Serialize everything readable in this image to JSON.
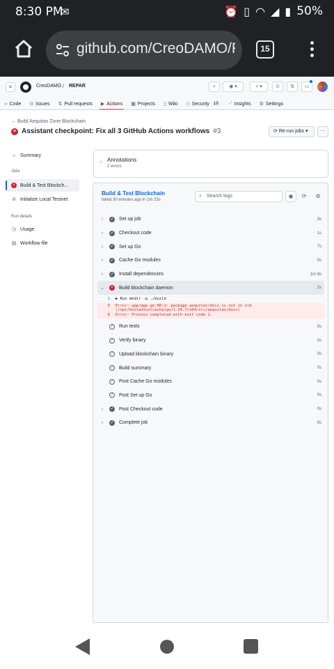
{
  "status_bar": {
    "time": "8:30 PM",
    "battery": "50%"
  },
  "browser": {
    "url": "github.com/CreoDAMO/R",
    "tab_count": "15"
  },
  "header": {
    "owner": "CreoDAMO",
    "separator": "/",
    "repo": "REPAR"
  },
  "repo_nav": [
    {
      "label": "Code",
      "icon": "code-icon"
    },
    {
      "label": "Issues",
      "icon": "issue-icon"
    },
    {
      "label": "Pull requests",
      "icon": "pull-request-icon"
    },
    {
      "label": "Actions",
      "icon": "actions-icon"
    },
    {
      "label": "Projects",
      "icon": "table-icon"
    },
    {
      "label": "Wiki",
      "icon": "book-icon"
    },
    {
      "label": "Security",
      "icon": "shield-icon",
      "count": "19"
    },
    {
      "label": "Insights",
      "icon": "graph-icon"
    },
    {
      "label": "Settings",
      "icon": "gear-icon"
    }
  ],
  "run": {
    "back_link": "Build Aequitas Zone Blockchain",
    "title": "Assistant checkpoint: Fix all 3 GitHub Actions workflows",
    "number": "#3",
    "rerun_label": "Re-run jobs"
  },
  "sidebar": {
    "summary": "Summary",
    "jobs_heading": "Jobs",
    "jobs": [
      {
        "label": "Build & Test Blockch...",
        "status": "failed"
      },
      {
        "label": "Initialize Local Testnet",
        "status": "skipped"
      }
    ],
    "run_details_heading": "Run details",
    "details": [
      {
        "label": "Usage"
      },
      {
        "label": "Workflow file"
      }
    ]
  },
  "annotations": {
    "title": "Annotations",
    "subtitle": "2 errors"
  },
  "job": {
    "name": "Build & Test Blockchain",
    "meta": "failed 30 minutes ago in 1m 23s",
    "search_placeholder": "Search logs"
  },
  "steps": [
    {
      "name": "Set up job",
      "duration": "3s",
      "status": "success",
      "expandable": true
    },
    {
      "name": "Checkout code",
      "duration": "1s",
      "status": "success",
      "expandable": true
    },
    {
      "name": "Set up Go",
      "duration": "7s",
      "status": "success",
      "expandable": true
    },
    {
      "name": "Cache Go modules",
      "duration": "0s",
      "status": "success",
      "expandable": true
    },
    {
      "name": "Install dependencies",
      "duration": "1m 8s",
      "status": "success",
      "expandable": true
    },
    {
      "name": "Build blockchain daemon",
      "duration": "2s",
      "status": "failure",
      "expandable": true,
      "expanded": true
    },
    {
      "name": "Run tests",
      "duration": "0s",
      "status": "skipped",
      "expandable": false
    },
    {
      "name": "Verify binary",
      "duration": "0s",
      "status": "skipped",
      "expandable": false
    },
    {
      "name": "Upload blockchain binary",
      "duration": "0s",
      "status": "skipped",
      "expandable": false
    },
    {
      "name": "Build summary",
      "duration": "0s",
      "status": "skipped",
      "expandable": false
    },
    {
      "name": "Post Cache Go modules",
      "duration": "0s",
      "status": "skipped",
      "expandable": false
    },
    {
      "name": "Post Set up Go",
      "duration": "0s",
      "status": "skipped",
      "expandable": false
    },
    {
      "name": "Post Checkout code",
      "duration": "0s",
      "status": "success",
      "expandable": true
    },
    {
      "name": "Complete job",
      "duration": "0s",
      "status": "success",
      "expandable": true
    }
  ],
  "log_lines": [
    {
      "n": "1",
      "text": "▶ Run mkdir -p ./build",
      "error": false
    },
    {
      "n": "5",
      "text": "Error: app/app.go:80:2: package aequitas/docs is not in std\n(/opt/hostedtoolcache/go/1.24.7/x64/src/aequitas/docs)",
      "error": true
    },
    {
      "n": "6",
      "text": "Error: Process completed with exit code 1.",
      "error": true
    }
  ],
  "colors": {
    "error": "#cf222e",
    "link": "#0969da",
    "active_tab_underline": "#fd8c73"
  }
}
